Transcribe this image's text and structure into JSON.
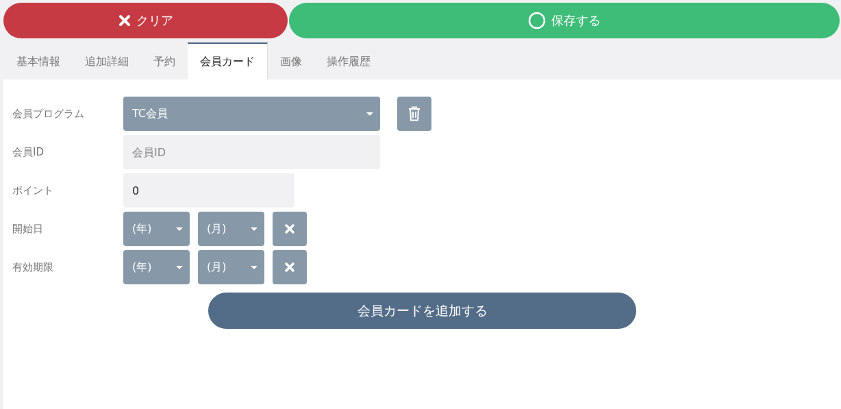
{
  "actions": [
    {
      "kind": "clear",
      "label": "クリア"
    },
    {
      "kind": "save",
      "label": "保存する"
    }
  ],
  "tabs": [
    {
      "label": "基本情報",
      "selected": false
    },
    {
      "label": "追加詳細",
      "selected": false
    },
    {
      "label": "予約",
      "selected": false
    },
    {
      "label": "会員カード",
      "selected": true
    },
    {
      "label": "画像",
      "selected": false
    },
    {
      "label": "操作履歴",
      "selected": false
    }
  ],
  "form": {
    "program": {
      "label": "会員プログラム",
      "value": "TC会員"
    },
    "member_id": {
      "label": "会員ID",
      "placeholder": "会員ID"
    },
    "points": {
      "label": "ポイント",
      "value": "0"
    },
    "dates": [
      {
        "label": "開始日",
        "year": "(年)",
        "month": "(月)"
      },
      {
        "label": "有効期限",
        "year": "(年)",
        "month": "(月)"
      }
    ]
  },
  "add_button": "会員カードを追加する"
}
